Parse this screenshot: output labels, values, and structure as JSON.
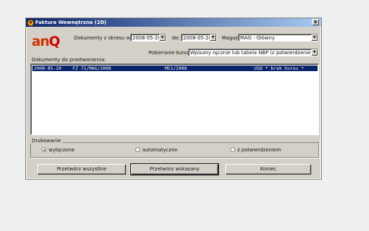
{
  "window": {
    "title": "Faktura Wewnętrzna (2D)",
    "close": "x"
  },
  "logo": {
    "text": "an",
    "accent": "Q"
  },
  "filters": {
    "date_from_label": "Dokumenty z okresu od:",
    "date_from": "2008-05-20",
    "date_to_label": "do:",
    "date_to": "2008-05-20",
    "warehouse_label": "Magazyn:",
    "warehouse": "MAG - Główny",
    "rate_label": "Pobieranie kursu:",
    "rate": "Wpisany ręcznie lub tabela NBP (z potwierdzeniem)"
  },
  "list": {
    "label": "Dokumenty do przetworzenia:",
    "rows": [
      {
        "date": "2008-05-20",
        "doc": "FZ 71/MAG/2008",
        "ms": "MS1/2008",
        "info": "USD * brak kursu *"
      }
    ]
  },
  "print": {
    "title": "Drukowanie",
    "options": [
      "wyłączone",
      "automatyczne",
      "z potwierdzeniem"
    ],
    "selected": 0
  },
  "buttons": {
    "process_all": "Przetwórz wszystkie",
    "process_selected": "Przetwórz wskazany",
    "close": "Koniec"
  }
}
